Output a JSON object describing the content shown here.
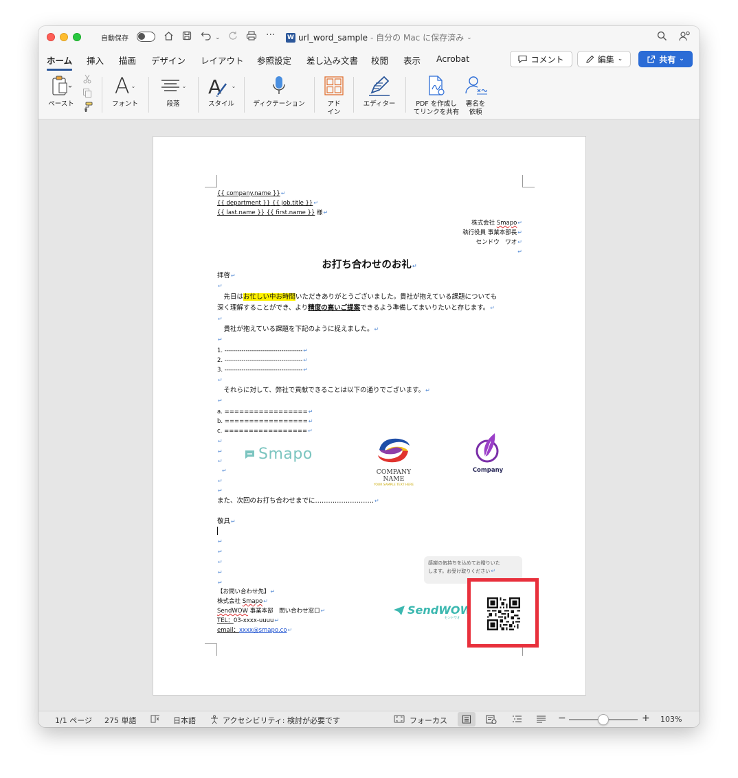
{
  "titlebar": {
    "autosave_label": "自動保存",
    "doc_name": "url_word_sample",
    "doc_status": "- 自分の Mac に保存済み",
    "word_badge": "W"
  },
  "tabs": [
    {
      "label": "ホーム",
      "active": true
    },
    {
      "label": "挿入"
    },
    {
      "label": "描画"
    },
    {
      "label": "デザイン"
    },
    {
      "label": "レイアウト"
    },
    {
      "label": "参照設定"
    },
    {
      "label": "差し込み文書"
    },
    {
      "label": "校閲"
    },
    {
      "label": "表示"
    },
    {
      "label": "Acrobat"
    }
  ],
  "actions": {
    "comment": "コメント",
    "edit": "編集",
    "share": "共有"
  },
  "toolbar": {
    "paste": "ペースト",
    "font": "フォント",
    "paragraph": "段落",
    "style": "スタイル",
    "dictation": "ディクテーション",
    "addin_line1": "アド",
    "addin_line2": "イン",
    "editor": "エディター",
    "pdf_line1": "PDF を作成し",
    "pdf_line2": "てリンクを共有",
    "sign_line1": "署名を",
    "sign_line2": "依頼"
  },
  "document": {
    "header_lines": {
      "company": "{{ company.name }}",
      "department": "{{ department }}",
      "job_title": " {{ job.title }}",
      "last_name": "{{ last.name }}",
      "first_name": " {{ first.name }}",
      "honorific": " 様"
    },
    "sender": {
      "company": "株式会社 ",
      "company_name": "Smapo",
      "position": "執行役員 事業本部長",
      "name": "センドウ　ワオ"
    },
    "title": "お打ち合わせのお礼",
    "greeting": "拝啓",
    "p1_a": "　先日は",
    "p1_hl": "お忙しい中お時間",
    "p1_b": "いただきありがとうございました。貴社が抱えている課題についても",
    "p2_a": "深く理解することができ、より",
    "p2_bold": "精度の高いご提案",
    "p2_b": "できるよう準備してまいりたいと存じます。",
    "p3": "　貴社が抱えている課題を下記のように捉えました。",
    "list_num": [
      "1. -------------------------------------",
      "2. -------------------------------------",
      "3. -------------------------------------"
    ],
    "p4": "　それらに対して、弊社で貢献できることは以下の通りでございます。",
    "list_alpha": [
      "a. =================",
      "b. =================",
      "c. ================="
    ],
    "logo_smapo": "Smapo",
    "logo_company_name": "COMPANY NAME",
    "logo_company_tag": "YOUR SAMPLE TEXT HERE",
    "logo_company2": "Company",
    "p5": "また、次回のお打ち合わせまでに………………………",
    "closing": "敬具",
    "contact": {
      "heading": "【お問い合わせ先】",
      "company_prefix": "株式会社 ",
      "company_name": "Smapo",
      "dept_name": "SendWOW",
      "dept_rest": " 事業本部　問い合わせ窓口",
      "tel_label": "TEL：",
      "tel": "03-xxxx-uuuu",
      "email_label": "email：",
      "email": "xxxx@smapo.co"
    },
    "logo_sendwow": "SendWOW",
    "logo_sendwow_sub": "センドワオ",
    "bubble_line1": "感謝の気持ちを込めてお贈りいた",
    "bubble_line2": "します。お受け取りください"
  },
  "status": {
    "page": "1/1 ページ",
    "words": "275 単語",
    "language": "日本語",
    "accessibility": "アクセシビリティ: 検討が必要です",
    "focus": "フォーカス",
    "zoom": "103%"
  },
  "colors": {
    "accent": "#2b579a",
    "share_button": "#2b6cd6",
    "highlight": "#fff200",
    "qr_frame": "#e8303c"
  }
}
